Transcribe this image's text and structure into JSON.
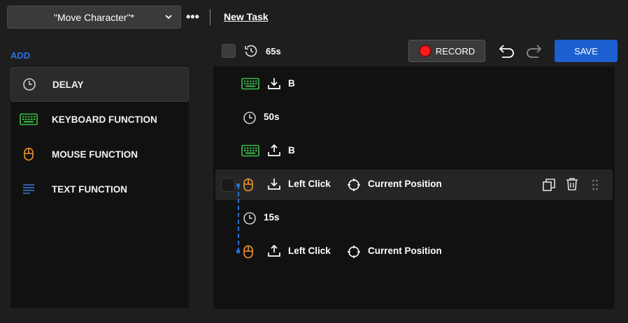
{
  "header": {
    "task_name": "\"Move Character\"*",
    "more_label": "•••",
    "new_task_label": "New Task"
  },
  "add_panel": {
    "title": "ADD",
    "items": [
      {
        "label": "DELAY",
        "icon": "clock-icon"
      },
      {
        "label": "KEYBOARD FUNCTION",
        "icon": "keyboard-icon"
      },
      {
        "label": "MOUSE FUNCTION",
        "icon": "mouse-icon"
      },
      {
        "label": "TEXT FUNCTION",
        "icon": "text-lines-icon"
      }
    ]
  },
  "toolbar": {
    "total_time": "65s",
    "record_label": "RECORD",
    "save_label": "SAVE"
  },
  "steps": [
    {
      "type": "keyboard",
      "action": "press-down",
      "key": "B"
    },
    {
      "type": "delay",
      "duration": "50s"
    },
    {
      "type": "keyboard",
      "action": "release-up",
      "key": "B"
    },
    {
      "type": "mouse",
      "action": "press-down",
      "button": "Left Click",
      "position": "Current Position",
      "selected": true
    },
    {
      "type": "delay",
      "duration": "15s"
    },
    {
      "type": "mouse",
      "action": "release-up",
      "button": "Left Click",
      "position": "Current Position"
    }
  ],
  "colors": {
    "accent_blue": "#1d5fd1",
    "keyboard_green": "#3fbf4a",
    "mouse_orange": "#f0962a",
    "text_blue": "#3a7ae0",
    "record_red": "#ff1a1a"
  }
}
